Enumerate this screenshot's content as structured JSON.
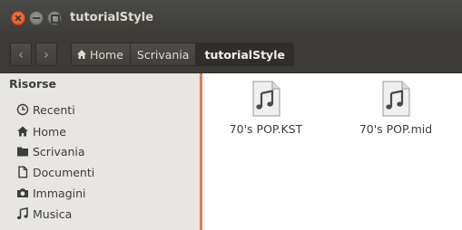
{
  "window": {
    "title": "tutorialStyle"
  },
  "toolbar": {
    "breadcrumbs": [
      "Home",
      "Scrivania",
      "tutorialStyle"
    ]
  },
  "sidebar": {
    "section": "Risorse",
    "items": [
      {
        "label": "Recenti",
        "icon": "clock-icon"
      },
      {
        "label": "Home",
        "icon": "home-icon"
      },
      {
        "label": "Scrivania",
        "icon": "folder-icon"
      },
      {
        "label": "Documenti",
        "icon": "document-icon"
      },
      {
        "label": "Immagini",
        "icon": "camera-icon"
      },
      {
        "label": "Musica",
        "icon": "music-note-icon"
      }
    ]
  },
  "files": [
    {
      "name": "70's POP.KST",
      "icon": "audio-file-icon"
    },
    {
      "name": "70's POP.mid",
      "icon": "audio-file-icon"
    }
  ],
  "colors": {
    "accent": "#ea7a4a",
    "titlebar": "#3c3b37",
    "close": "#df4a16"
  }
}
